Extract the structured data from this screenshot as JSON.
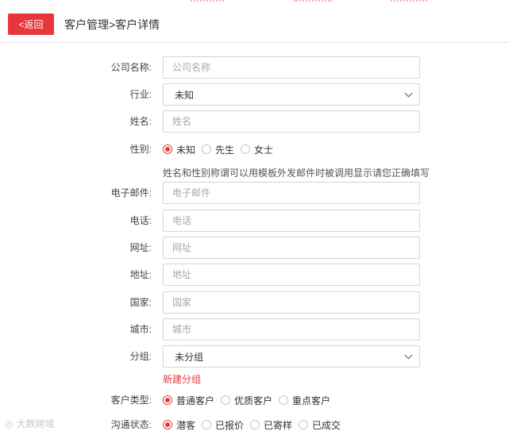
{
  "header": {
    "back_label": "<返回",
    "title": "客户管理>客户详情"
  },
  "form": {
    "company": {
      "label": "公司名称:",
      "placeholder": "公司名称"
    },
    "industry": {
      "label": "行业:",
      "value": "未知"
    },
    "name": {
      "label": "姓名:",
      "placeholder": "姓名"
    },
    "gender": {
      "label": "性别:",
      "options": [
        "未知",
        "先生",
        "女士"
      ],
      "selected": "未知"
    },
    "hint": "姓名和性别称谓可以用模板外发邮件时被调用显示请您正确填写",
    "email": {
      "label": "电子邮件:",
      "placeholder": "电子邮件"
    },
    "phone": {
      "label": "电话:",
      "placeholder": "电话"
    },
    "website": {
      "label": "网址:",
      "placeholder": "网址"
    },
    "address": {
      "label": "地址:",
      "placeholder": "地址"
    },
    "country": {
      "label": "国家:",
      "placeholder": "国家"
    },
    "city": {
      "label": "城市:",
      "placeholder": "城市"
    },
    "group": {
      "label": "分组:",
      "value": "未分组"
    },
    "new_group_link": "新建分组",
    "customer_type": {
      "label": "客户类型:",
      "options": [
        "普通客户",
        "优质客户",
        "重点客户"
      ],
      "selected": "普通客户"
    },
    "contact_status": {
      "label": "沟通状态:",
      "options": [
        "潜客",
        "已报价",
        "已寄样",
        "已成交"
      ],
      "selected": "潜客"
    }
  },
  "watermark": {
    "text": "大数跨境"
  },
  "colors": {
    "accent": "#e8373b",
    "border": "#d5d5d5"
  }
}
